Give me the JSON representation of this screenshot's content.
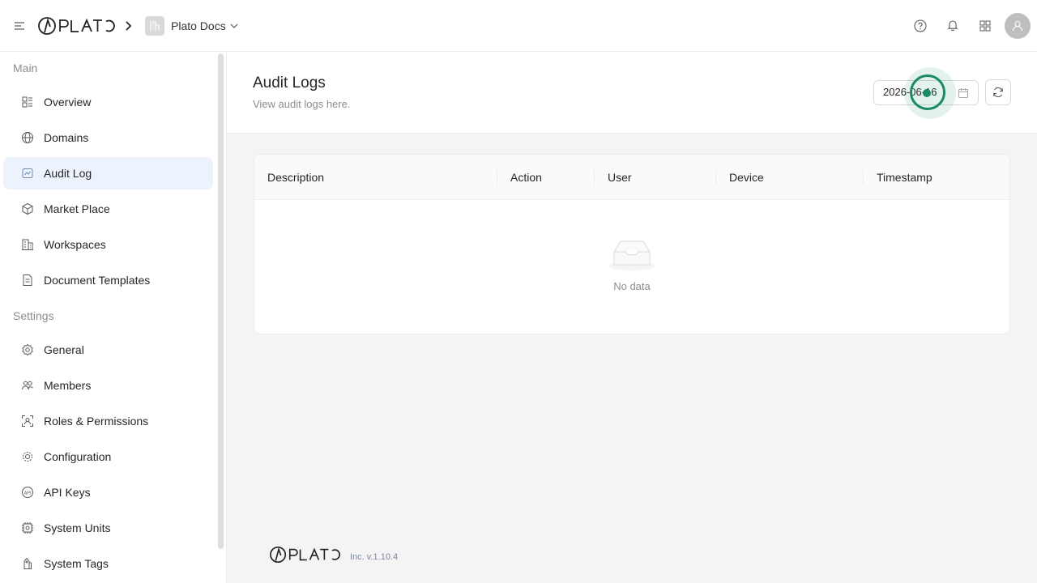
{
  "brand": {
    "logo_text": "PLATO"
  },
  "breadcrumb": {
    "workspace": "Plato Docs"
  },
  "sidebar": {
    "main_title": "Main",
    "settings_title": "Settings",
    "main_items": [
      {
        "label": "Overview"
      },
      {
        "label": "Domains"
      },
      {
        "label": "Audit Log"
      },
      {
        "label": "Market Place"
      },
      {
        "label": "Workspaces"
      },
      {
        "label": "Document Templates"
      }
    ],
    "settings_items": [
      {
        "label": "General"
      },
      {
        "label": "Members"
      },
      {
        "label": "Roles & Permissions"
      },
      {
        "label": "Configuration"
      },
      {
        "label": "API Keys"
      },
      {
        "label": "System Units"
      },
      {
        "label": "System Tags"
      }
    ]
  },
  "page": {
    "title": "Audit Logs",
    "subtitle": "View audit logs here.",
    "date_value": "2026-06-16"
  },
  "table": {
    "columns": [
      "Description",
      "Action",
      "User",
      "Device",
      "Timestamp"
    ],
    "empty_text": "No data"
  },
  "footer": {
    "logo_text": "PLATO",
    "version": "Inc. v.1.10.4"
  },
  "colors": {
    "accent": "#1a8a63",
    "active_bg": "#edf3fc"
  }
}
